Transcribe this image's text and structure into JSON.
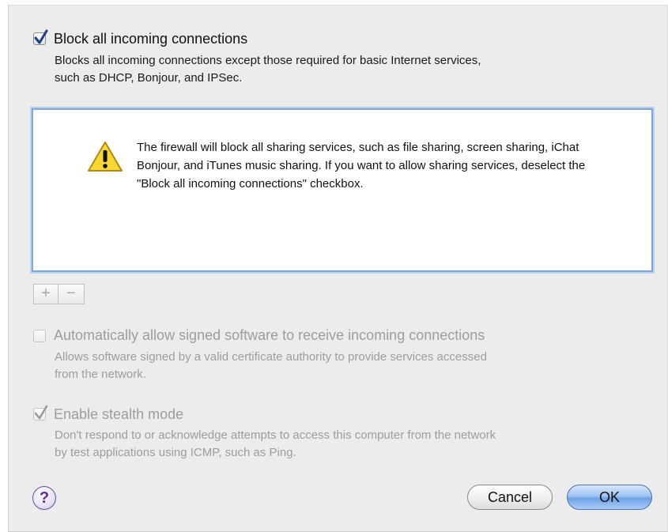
{
  "block_all": {
    "checked": true,
    "label": "Block all incoming connections",
    "description_line1": "Blocks all incoming connections except those required for basic Internet services,",
    "description_line2": "such as DHCP, Bonjour, and IPSec."
  },
  "warning": {
    "icon": "warning-triangle-icon",
    "text": "The firewall will block all sharing services, such as file sharing, screen sharing, iChat Bonjour, and iTunes music sharing. If you want to allow sharing services, deselect the \"Block all incoming connections\" checkbox."
  },
  "list_controls": {
    "add_label": "+",
    "remove_label": "−"
  },
  "auto_allow": {
    "checked": false,
    "enabled": false,
    "label": "Automatically allow signed software to receive incoming connections",
    "description_line1": "Allows software signed by a valid certificate authority to provide services accessed",
    "description_line2": "from the network."
  },
  "stealth": {
    "checked": true,
    "enabled": false,
    "label": "Enable stealth mode",
    "description_line1": "Don't respond to or acknowledge attempts to access this computer from the network",
    "description_line2": "by test applications using ICMP, such as Ping."
  },
  "footer": {
    "help_label": "?",
    "cancel_label": "Cancel",
    "ok_label": "OK"
  },
  "colors": {
    "panel_bg": "#ececec",
    "focus_ring": "#7fa7d9",
    "default_button": "#9ec3f3",
    "disabled_text": "#9d9d9d"
  }
}
